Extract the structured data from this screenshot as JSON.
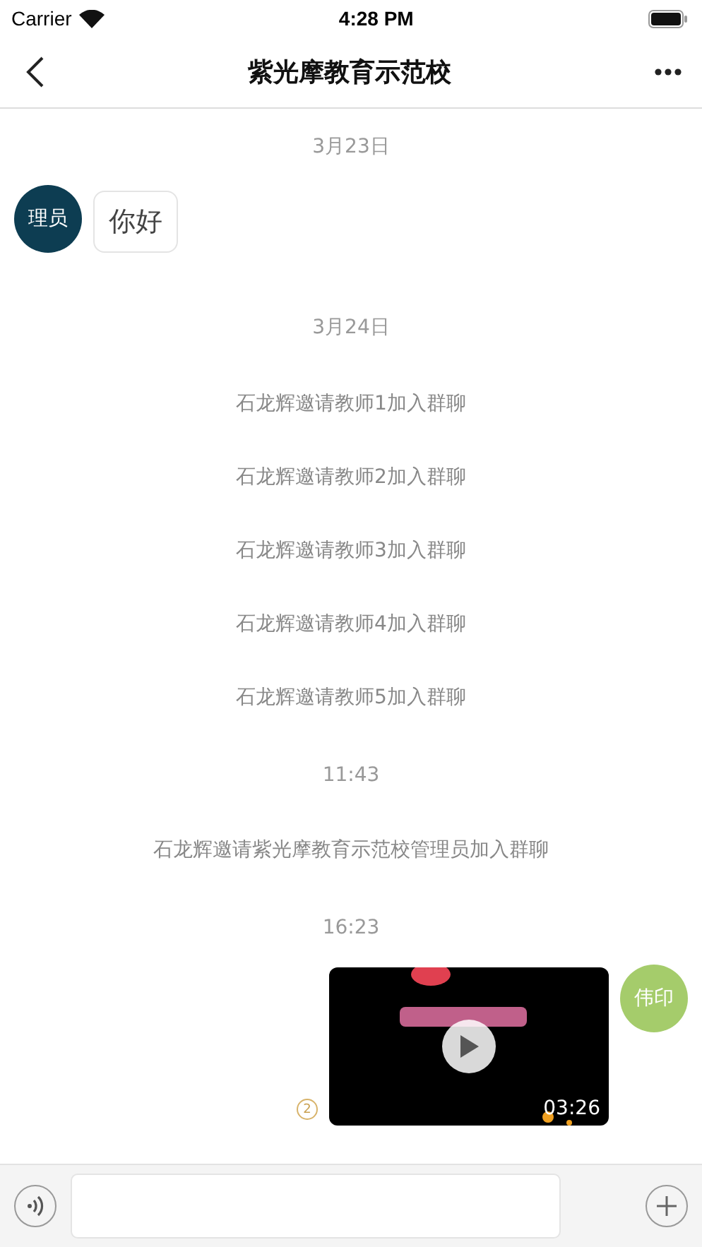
{
  "status_bar": {
    "carrier": "Carrier",
    "time": "4:28 PM"
  },
  "nav": {
    "title": "紫光摩教育示范校"
  },
  "messages": [
    {
      "kind": "time",
      "text": "3月23日"
    },
    {
      "kind": "text",
      "avatar": "理员",
      "color": "#0d3d52",
      "text": "你好"
    },
    {
      "kind": "time",
      "text": "3月24日"
    },
    {
      "kind": "system",
      "text": "石龙辉邀请教师1加入群聊"
    },
    {
      "kind": "system",
      "text": "石龙辉邀请教师2加入群聊"
    },
    {
      "kind": "system",
      "text": "石龙辉邀请教师3加入群聊"
    },
    {
      "kind": "system",
      "text": "石龙辉邀请教师4加入群聊"
    },
    {
      "kind": "system",
      "text": "石龙辉邀请教师5加入群聊"
    },
    {
      "kind": "time",
      "text": "11:43"
    },
    {
      "kind": "system",
      "text": "石龙辉邀请紫光摩教育示范校管理员加入群聊"
    },
    {
      "kind": "time",
      "text": "16:23"
    },
    {
      "kind": "video",
      "avatar": "伟印",
      "color": "#a5cc6b",
      "duration": "03:26",
      "read_count": "2"
    }
  ]
}
